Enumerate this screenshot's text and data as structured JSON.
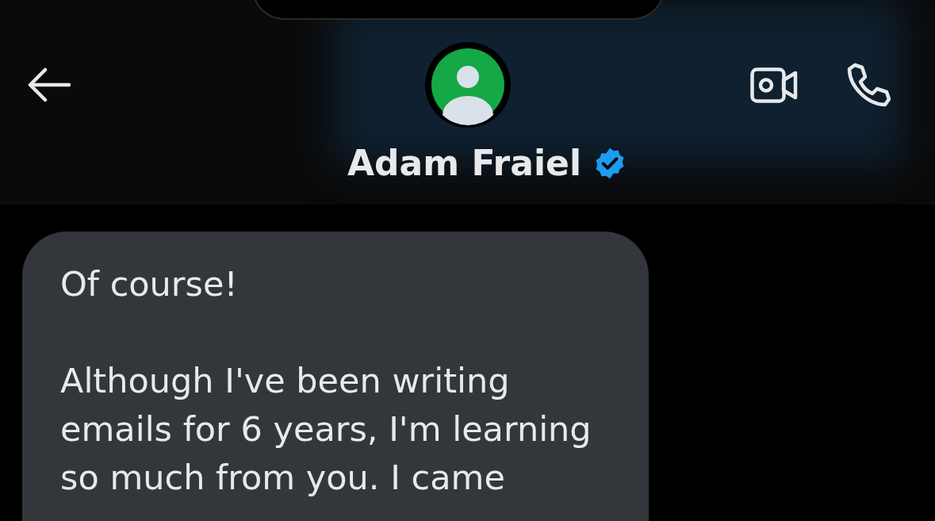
{
  "header": {
    "name": "Adam Fraiel",
    "verified": true
  },
  "messages": [
    {
      "text": "Of course!\n\nAlthough I've been writing\nemails for 6 years, I'm learning\nso much from you. I came"
    }
  ]
}
